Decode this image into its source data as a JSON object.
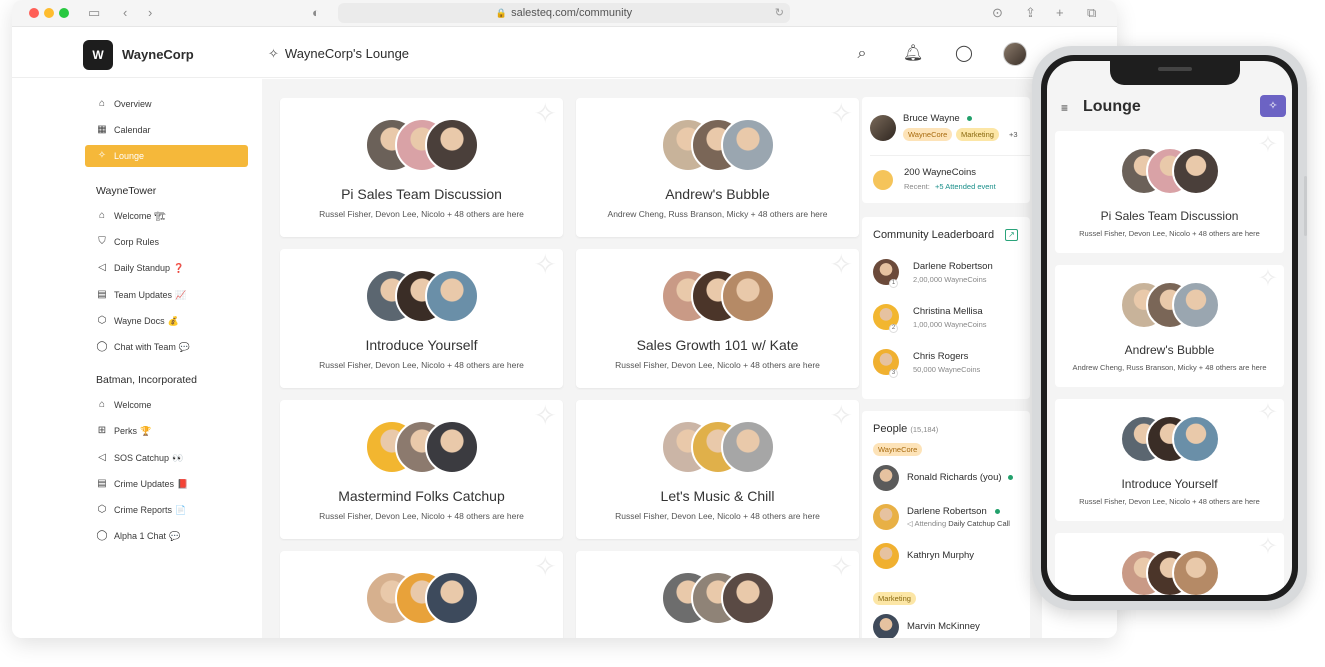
{
  "browser": {
    "url": "salesteq.com/community"
  },
  "header": {
    "brand": "WayneCorp",
    "logo_text": "W",
    "page_title": "WayneCorp's Lounge"
  },
  "sidebar": {
    "top_items": [
      {
        "label": "Overview",
        "icon": "home-icon"
      },
      {
        "label": "Calendar",
        "icon": "calendar-icon"
      },
      {
        "label": "Lounge",
        "icon": "sparkle-icon",
        "active": true
      }
    ],
    "sections": [
      {
        "title": "WayneTower",
        "items": [
          {
            "label": "Welcome",
            "emoji": "🏗",
            "icon": "home-icon"
          },
          {
            "label": "Corp Rules",
            "icon": "shield-icon"
          },
          {
            "label": "Daily Standup",
            "emoji": "❓",
            "icon": "megaphone-icon"
          },
          {
            "label": "Team Updates",
            "emoji": "📈",
            "icon": "document-icon"
          },
          {
            "label": "Wayne Docs",
            "emoji": "💰",
            "icon": "box-icon"
          },
          {
            "label": "Chat with Team",
            "emoji": "💬",
            "icon": "chat-icon"
          }
        ]
      },
      {
        "title": "Batman, Incorporated",
        "items": [
          {
            "label": "Welcome",
            "icon": "home-icon"
          },
          {
            "label": "Perks",
            "emoji": "🏆",
            "icon": "gift-icon"
          },
          {
            "label": "SOS Catchup",
            "emoji": "👀",
            "icon": "megaphone-icon"
          },
          {
            "label": "Crime Updates",
            "emoji": "📕",
            "icon": "document-icon"
          },
          {
            "label": "Crime Reports",
            "emoji": "📄",
            "icon": "box-icon"
          },
          {
            "label": "Alpha 1 Chat",
            "emoji": "💬",
            "icon": "chat-icon"
          }
        ]
      }
    ]
  },
  "cards": [
    {
      "title": "Pi Sales Team Discussion",
      "subtitle": "Russel Fisher, Devon Lee, Nicolo + 48 others are here",
      "colors": [
        "#6b6159",
        "#d9a2a6",
        "#4a3f3a"
      ]
    },
    {
      "title": "Andrew's Bubble",
      "subtitle": "Andrew Cheng, Russ Branson, Micky + 48 others are here",
      "colors": [
        "#c8b39a",
        "#7a6657",
        "#9aa6b0"
      ]
    },
    {
      "title": "Introduce Yourself",
      "subtitle": "Russel Fisher, Devon Lee, Nicolo + 48 others are here",
      "colors": [
        "#5b6670",
        "#3a2d26",
        "#6a8fa8"
      ]
    },
    {
      "title": "Sales Growth 101 w/ Kate",
      "subtitle": "Russel Fisher, Devon Lee, Nicolo + 48 others are here",
      "colors": [
        "#c99a86",
        "#4b3529",
        "#b58a66"
      ]
    },
    {
      "title": "Mastermind Folks Catchup",
      "subtitle": "Russel Fisher, Devon Lee, Nicolo + 48 others are here",
      "colors": [
        "#f2b630",
        "#8c7a6e",
        "#3b3b40"
      ]
    },
    {
      "title": "Let's Music & Chill",
      "subtitle": "Russel Fisher, Devon Lee, Nicolo + 48 others are here",
      "colors": [
        "#cbb5a6",
        "#e0b04a",
        "#a6a6a6"
      ]
    },
    {
      "title": "",
      "subtitle": "",
      "colors": [
        "#d6b08e",
        "#e8a23a",
        "#3d4a5c"
      ]
    },
    {
      "title": "",
      "subtitle": "",
      "colors": [
        "#6d6d6d",
        "#8f8377",
        "#5a4a44"
      ]
    }
  ],
  "profile": {
    "name": "Bruce Wayne",
    "tags": [
      "WayneCore",
      "Marketing"
    ],
    "more_tags": "+3",
    "coins": "200 WayneCoins",
    "recent_label": "Recent:",
    "recent_value": "+5 Attended event"
  },
  "leaderboard": {
    "title": "Community Leaderboard",
    "entries": [
      {
        "rank": "1",
        "name": "Darlene Robertson",
        "coins": "2,00,000 WayneCoins",
        "color": "#6b4a3a"
      },
      {
        "rank": "2",
        "name": "Christina Mellisa",
        "coins": "1,00,000 WayneCoins",
        "color": "#f2b630"
      },
      {
        "rank": "3",
        "name": "Chris Rogers",
        "coins": "50,000 WayneCoins",
        "color": "#f0b030"
      }
    ]
  },
  "people": {
    "title": "People",
    "count": "(15,184)",
    "groups": [
      {
        "tag": "WayneCore",
        "members": [
          {
            "name": "Ronald Richards (you)",
            "status": "",
            "color": "#5b5b5b"
          },
          {
            "name": "Darlene Robertson",
            "status_prefix": "Attending",
            "status": "Daily Catchup Call",
            "color": "#e8b045"
          },
          {
            "name": "Kathryn Murphy",
            "status": "",
            "color": "#f0b030"
          }
        ]
      },
      {
        "tag": "Marketing",
        "members": [
          {
            "name": "Marvin McKinney",
            "status": "",
            "color": "#3f4a5a"
          }
        ]
      }
    ]
  },
  "phone": {
    "title": "Lounge",
    "cards": [
      {
        "title": "Pi Sales Team Discussion",
        "subtitle": "Russel Fisher, Devon Lee, Nicolo + 48 others are here",
        "colors": [
          "#6b6159",
          "#d9a2a6",
          "#4a3f3a"
        ]
      },
      {
        "title": "Andrew's Bubble",
        "subtitle": "Andrew Cheng, Russ Branson, Micky + 48 others are here",
        "colors": [
          "#c8b39a",
          "#7a6657",
          "#9aa6b0"
        ]
      },
      {
        "title": "Introduce Yourself",
        "subtitle": "Russel Fisher, Devon Lee, Nicolo + 48 others are here",
        "colors": [
          "#5b6670",
          "#3a2d26",
          "#6a8fa8"
        ]
      },
      {
        "title": "",
        "subtitle": "",
        "colors": [
          "#c99a86",
          "#4b3529",
          "#b58a66"
        ]
      }
    ]
  },
  "colors": {
    "accent": "#f5b83a",
    "phone_button": "#6c63c4",
    "online": "#22a06b",
    "link": "#1a8f8a"
  }
}
